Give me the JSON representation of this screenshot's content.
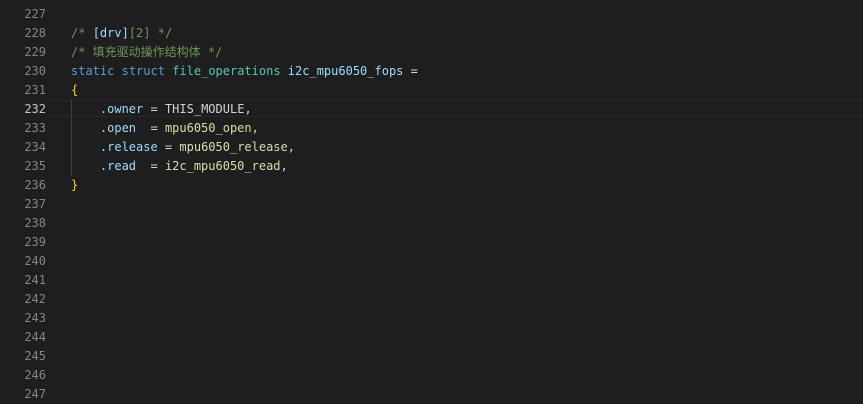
{
  "editor": {
    "line_numbers": [
      "227",
      "228",
      "229",
      "230",
      "231",
      "232",
      "233",
      "234",
      "235",
      "236",
      "237",
      "238",
      "239",
      "240",
      "241",
      "242",
      "243",
      "244",
      "245",
      "246",
      "247"
    ],
    "active_line": "232",
    "code": {
      "l228": {
        "comment_open": "/* ",
        "tag_drv": "[drv]",
        "tag_num": "[2]",
        "comment_close": " */"
      },
      "l229": {
        "comment": "/* 填充驱动操作结构体 */"
      },
      "l230": {
        "kw_static": "static",
        "kw_struct": "struct",
        "type_name": "file_operations",
        "var_name": "i2c_mpu6050_fops",
        "assign": " ="
      },
      "l231": {
        "brace_open": "{"
      },
      "l232": {
        "field": ".owner",
        "op": " = ",
        "value": "THIS_MODULE",
        "comma": ","
      },
      "l233": {
        "field": ".open",
        "op": "  = ",
        "value": "mpu6050_open",
        "comma": ","
      },
      "l234": {
        "field": ".release",
        "op": " = ",
        "value": "mpu6050_release",
        "comma": ","
      },
      "l235": {
        "field": ".read",
        "op": "  = ",
        "value": "i2c_mpu6050_read",
        "comma": ","
      },
      "l236": {
        "brace_close": "}"
      }
    },
    "colors": {
      "background": "#1e1e1e",
      "comment": "#6a9955",
      "keyword": "#569cd6",
      "type": "#4ec9b0",
      "function": "#dcdcaa",
      "variable": "#9cdcfe",
      "bracket": "#ffd700",
      "line_number": "#858585",
      "active_line_number": "#c6c6c6"
    }
  }
}
